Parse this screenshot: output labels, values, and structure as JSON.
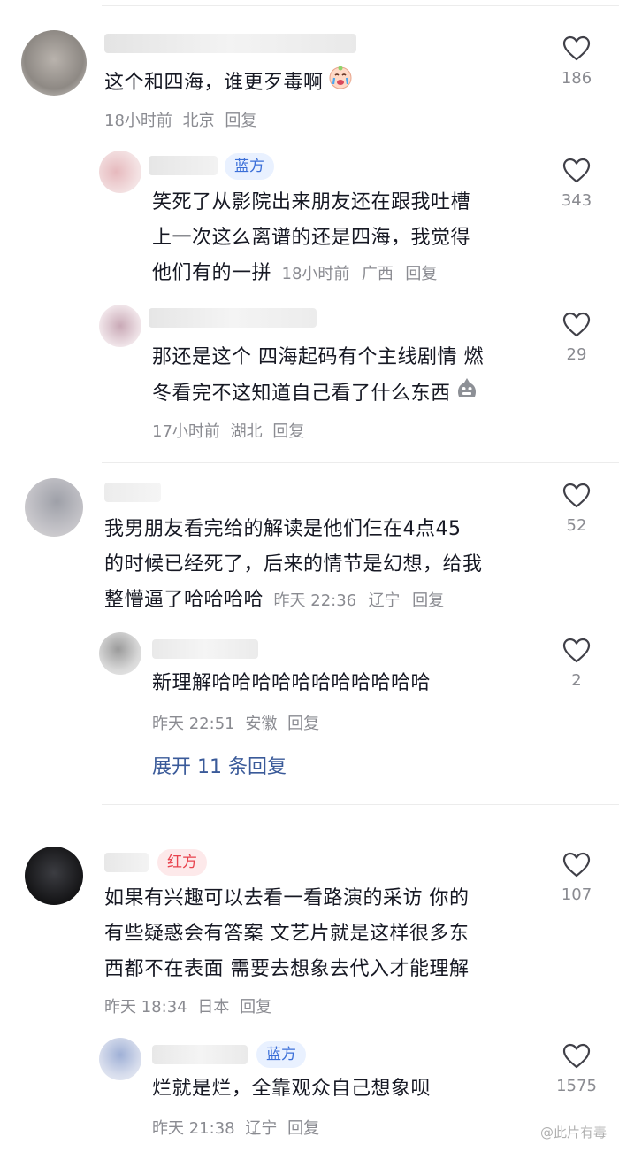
{
  "comments": [
    {
      "text_lines": [
        "这个和四海，谁更歹毒啊"
      ],
      "emoji": "crying-baby-emoji",
      "meta": {
        "time": "18小时前",
        "location": "北京",
        "reply": "回复"
      },
      "likes": "186",
      "replies": [
        {
          "badge": "蓝方",
          "text_lines": [
            "笑死了从影院出来朋友还在跟我吐槽",
            "上一次这么离谱的还是四海，我觉得",
            "他们有的一拼"
          ],
          "meta": {
            "time": "18小时前",
            "location": "广西",
            "reply": "回复"
          },
          "likes": "343"
        },
        {
          "text_lines": [
            "那还是这个 四海起码有个主线剧情 燃",
            "冬看完不这知道自己看了什么东西"
          ],
          "emoji": "grimace-bag-emoji",
          "meta": {
            "time": "17小时前",
            "location": "湖北",
            "reply": "回复"
          },
          "likes": "29"
        }
      ]
    },
    {
      "text_lines": [
        "我男朋友看完给的解读是他们仨在4点45",
        "的时候已经死了，后来的情节是幻想，给我",
        "整懵逼了哈哈哈哈"
      ],
      "meta": {
        "time": "昨天 22:36",
        "location": "辽宁",
        "reply": "回复"
      },
      "likes": "52",
      "replies": [
        {
          "text_lines": [
            "新理解哈哈哈哈哈哈哈哈哈哈哈"
          ],
          "meta": {
            "time": "昨天 22:51",
            "location": "安徽",
            "reply": "回复"
          },
          "likes": "2"
        }
      ],
      "expand_label": "展开 11 条回复"
    },
    {
      "badge": "红方",
      "text_lines": [
        "如果有兴趣可以去看一看路演的采访 你的",
        "有些疑惑会有答案 文艺片就是这样很多东",
        "西都不在表面 需要去想象去代入才能理解"
      ],
      "meta": {
        "time": "昨天 18:34",
        "location": "日本",
        "reply": "回复"
      },
      "likes": "107",
      "replies": [
        {
          "badge": "蓝方",
          "text_lines": [
            "烂就是烂，全靠观众自己想象呗"
          ],
          "meta": {
            "time": "昨天 21:38",
            "location": "辽宁",
            "reply": "回复"
          },
          "likes": "1575"
        }
      ]
    }
  ],
  "watermark": "@此片有毒",
  "colors": {
    "badge_blue": "#3b6fd8",
    "badge_red": "#e8434e",
    "link": "#3a5a99",
    "meta": "#8a8b91"
  }
}
